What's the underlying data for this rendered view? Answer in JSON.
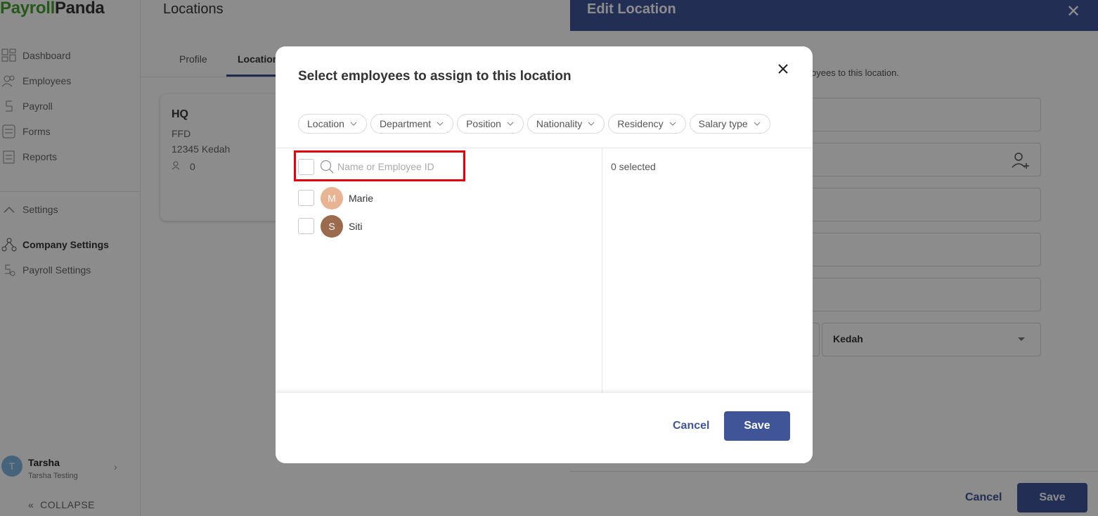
{
  "app": {
    "logo_part1": "Payroll",
    "logo_part2": "Panda",
    "accent": "#45a02f",
    "primary": "#3f5597"
  },
  "sidebar": {
    "items": [
      {
        "label": "Dashboard",
        "icon": "dashboard-icon"
      },
      {
        "label": "Employees",
        "icon": "employees-icon"
      },
      {
        "label": "Payroll",
        "icon": "payroll-icon"
      },
      {
        "label": "Forms",
        "icon": "forms-icon"
      },
      {
        "label": "Reports",
        "icon": "reports-icon"
      }
    ],
    "settings_label": "Settings",
    "company_settings": "Company Settings",
    "payroll_settings": "Payroll Settings",
    "user": {
      "initial": "T",
      "name": "Tarsha",
      "company": "Tarsha Testing"
    },
    "collapse": "COLLAPSE"
  },
  "page": {
    "title": "Locations",
    "tabs": [
      {
        "label": "Profile"
      },
      {
        "label": "Locations"
      }
    ],
    "card": {
      "name": "HQ",
      "line1": "FFD",
      "line2": "12345 Kedah",
      "count": "0"
    }
  },
  "drawer": {
    "title": "Edit Location",
    "hint": "oyees to this location.",
    "state_value": "Kedah",
    "cancel": "Cancel",
    "save": "Save"
  },
  "modal": {
    "title": "Select employees to assign to this location",
    "filters": [
      "Location",
      "Department",
      "Position",
      "Nationality",
      "Residency",
      "Salary type"
    ],
    "search_placeholder": "Name or Employee ID",
    "employees": [
      {
        "initial": "M",
        "name": "Marie",
        "color": "#e8b494"
      },
      {
        "initial": "S",
        "name": "Siti",
        "color": "#9c6b4e"
      }
    ],
    "selected_count": "0 selected",
    "cancel": "Cancel",
    "save": "Save"
  }
}
